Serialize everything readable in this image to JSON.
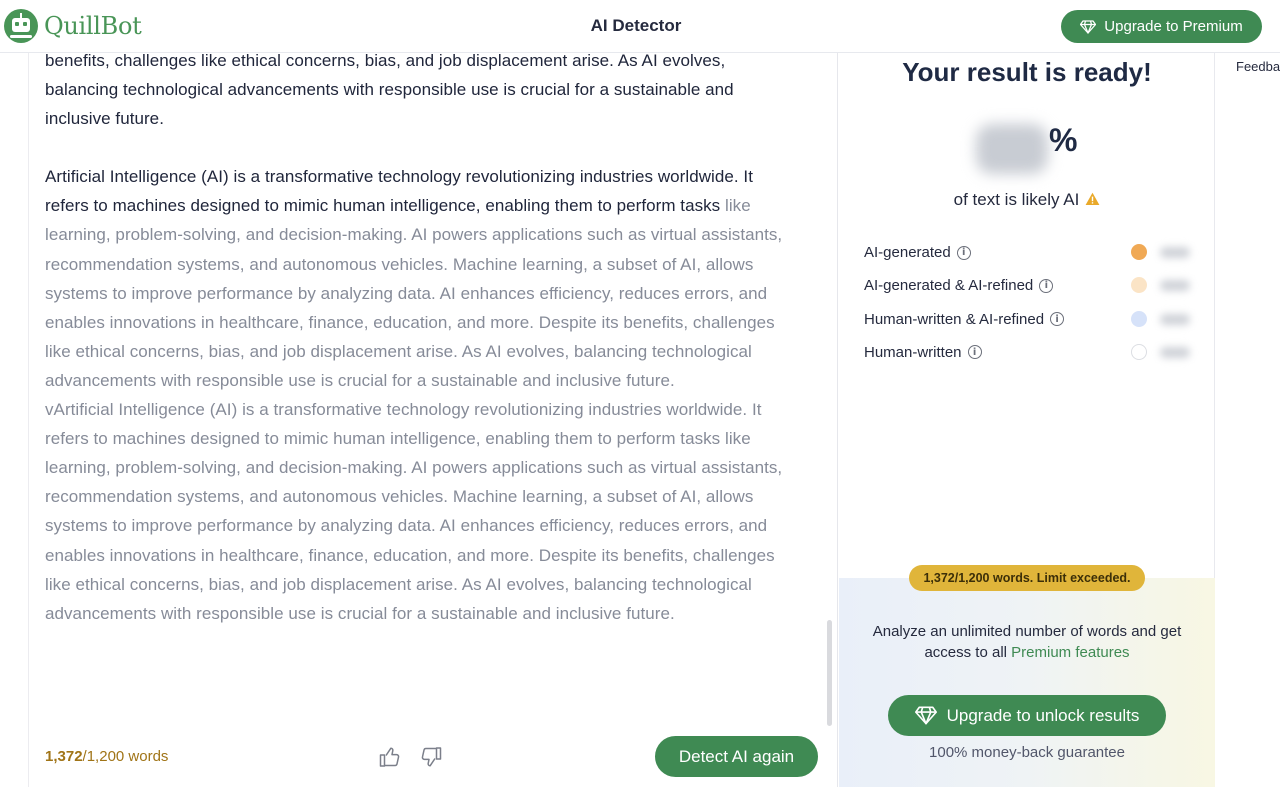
{
  "header": {
    "logo_text": "QuillBot",
    "title": "AI Detector",
    "premium_button": "Upgrade to Premium"
  },
  "editor": {
    "para1": {
      "dark": "benefits, challenges like ethical concerns, bias, and job displacement arise. As AI evolves, balancing technological advancements with responsible use is crucial for a sustainable and inclusive future."
    },
    "para2": {
      "dark": "Artificial Intelligence (AI) is a transformative technology revolutionizing industries worldwide. It refers to machines designed to mimic human intelligence, enabling them to perform tasks ",
      "light": "like learning, problem-solving, and decision-making. AI powers applications such as virtual assistants, recommendation systems, and autonomous vehicles. Machine learning, a subset of AI, allows systems to improve performance by analyzing data. AI enhances efficiency, reduces errors, and enables innovations in healthcare, finance, education, and more. Despite its benefits, challenges like ethical concerns, bias, and job displacement arise. As AI evolves, balancing technological advancements with responsible use is crucial for a sustainable and inclusive future."
    },
    "para3": {
      "light": "vArtificial Intelligence (AI) is a transformative technology revolutionizing industries worldwide. It refers to machines designed to mimic human intelligence, enabling them to perform tasks like learning, problem-solving, and decision-making. AI powers applications such as virtual assistants, recommendation systems, and autonomous vehicles. Machine learning, a subset of AI, allows systems to improve performance by analyzing data. AI enhances efficiency, reduces errors, and enables innovations in healthcare, finance, education, and more. Despite its benefits, challenges like ethical concerns, bias, and job displacement arise. As AI evolves, balancing technological advancements with responsible use is crucial for a sustainable and inclusive future."
    },
    "word_count": {
      "current": "1,372",
      "limit": "/1,200 words"
    },
    "detect_button": "Detect AI again"
  },
  "result": {
    "title": "Your result is ready!",
    "percent_sign": "%",
    "likely_text": "of text is likely AI",
    "legend": [
      {
        "label": "AI-generated",
        "color": "#f0a955"
      },
      {
        "label": "AI-generated & AI-refined",
        "color": "#fbe4c6"
      },
      {
        "label": "Human-written & AI-refined",
        "color": "#d6e2f9"
      },
      {
        "label": "Human-written",
        "color": "#ffffff"
      }
    ],
    "limit_badge": "1,372/1,200 words. Limit exceeded.",
    "upsell_text": "Analyze an unlimited number of words and get access to all ",
    "upsell_link": "Premium features",
    "unlock_button": "Upgrade to unlock results",
    "guarantee": "100% money-back guarantee"
  },
  "side": {
    "feedback": "Feedba"
  },
  "colors": {
    "brand_green": "#3f8a53",
    "warning": "#e0b53a"
  }
}
